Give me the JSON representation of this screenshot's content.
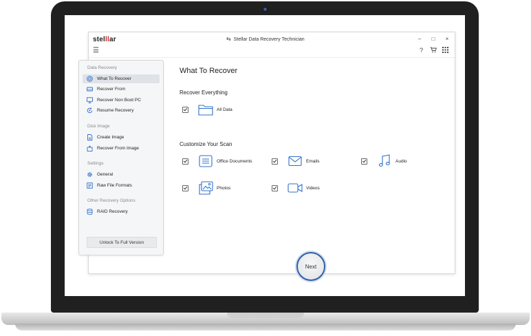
{
  "app": {
    "logo_part1": "stel",
    "logo_part2": "l",
    "logo_part3": "ar",
    "title": "Stellar Data Recovery Technician",
    "min_label": "–",
    "max_label": "□",
    "close_label": "×",
    "help_label": "?"
  },
  "sidebar": {
    "sections": [
      {
        "label": "Data Recovery",
        "items": [
          {
            "label": "What To Recover",
            "icon": "target-icon",
            "active": true
          },
          {
            "label": "Recover From",
            "icon": "drive-icon"
          },
          {
            "label": "Recover Non Boot PC",
            "icon": "monitor-icon"
          },
          {
            "label": "Resume Recovery",
            "icon": "resume-icon"
          }
        ]
      },
      {
        "label": "Disk Image",
        "items": [
          {
            "label": "Create Image",
            "icon": "create-image-icon"
          },
          {
            "label": "Recover From Image",
            "icon": "recover-image-icon"
          }
        ]
      },
      {
        "label": "Settings",
        "items": [
          {
            "label": "General",
            "icon": "gear-icon"
          },
          {
            "label": "Raw File Formats",
            "icon": "raw-formats-icon"
          }
        ]
      },
      {
        "label": "Other Recovery Options",
        "items": [
          {
            "label": "RAID Recovery",
            "icon": "raid-icon"
          }
        ]
      }
    ],
    "unlock_label": "Unlock To Full Version"
  },
  "main": {
    "heading": "What To Recover",
    "recover_everything": "Recover Everything",
    "all_data": "All Data",
    "customize": "Customize Your Scan",
    "options": [
      {
        "label": "Office Documents",
        "icon": "document-icon",
        "checked": true
      },
      {
        "label": "Emails",
        "icon": "email-icon",
        "checked": true
      },
      {
        "label": "Audio",
        "icon": "music-icon",
        "checked": true
      },
      {
        "label": "Photos",
        "icon": "photos-icon",
        "checked": true
      },
      {
        "label": "Videos",
        "icon": "video-icon",
        "checked": true
      }
    ],
    "all_data_checked": true,
    "next_label": "Next"
  },
  "colors": {
    "accent": "#2f6fc9",
    "logo_red": "#d42020",
    "next_ring": "#2f5fa8"
  }
}
